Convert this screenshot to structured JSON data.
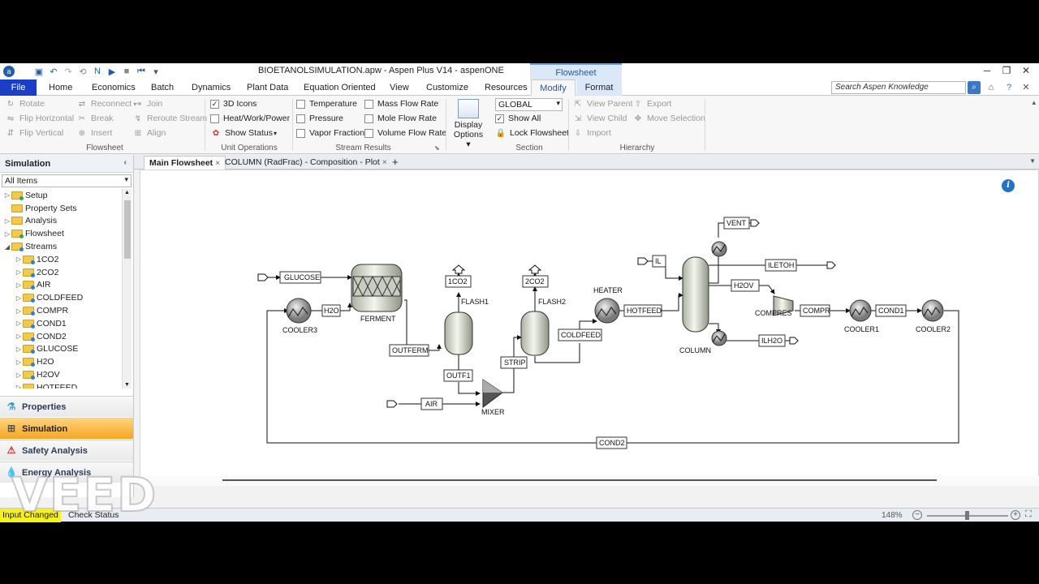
{
  "window": {
    "title": "BIOETANOLSIMULATION.apw - Aspen Plus V14 - aspenONE",
    "context_tab": "Flowsheet"
  },
  "ribbon_tabs": [
    "File",
    "Home",
    "Economics",
    "Batch",
    "Dynamics",
    "Plant Data",
    "Equation Oriented",
    "View",
    "Customize",
    "Resources",
    "Modify",
    "Format"
  ],
  "active_tab": "Modify",
  "search": {
    "placeholder": "Search Aspen Knowledge"
  },
  "ribbon": {
    "flowsheet_group": {
      "label": "Flowsheet",
      "rotate": "Rotate",
      "flip_h": "Flip Horizontal",
      "flip_v": "Flip Vertical",
      "reconnect": "Reconnect",
      "break": "Break",
      "insert": "Insert",
      "join": "Join",
      "reroute": "Reroute Stream",
      "align": "Align"
    },
    "unit_ops_group": {
      "label": "Unit Operations",
      "icons_3d": "3D Icons",
      "heat_work": "Heat/Work/Power",
      "show_status": "Show Status"
    },
    "stream_results_group": {
      "label": "Stream Results",
      "temperature": "Temperature",
      "pressure": "Pressure",
      "vapor_fraction": "Vapor Fraction",
      "mass_flow": "Mass Flow Rate",
      "mole_flow": "Mole Flow Rate",
      "volume_flow": "Volume Flow Rate"
    },
    "display_options": "Display Options",
    "section_group": {
      "label": "Section",
      "selected": "GLOBAL",
      "show_all": "Show All",
      "lock": "Lock Flowsheet"
    },
    "hierarchy_group": {
      "label": "Hierarchy",
      "view_parent": "View Parent",
      "view_child": "View Child",
      "import": "Import",
      "export": "Export",
      "move_selection": "Move Selection"
    }
  },
  "nav": {
    "header": "Simulation",
    "filter": "All Items",
    "tree": [
      {
        "label": "Setup",
        "level": 0,
        "exp": "▷",
        "mark": "green"
      },
      {
        "label": "Property Sets",
        "level": 0,
        "exp": "",
        "mark": ""
      },
      {
        "label": "Analysis",
        "level": 0,
        "exp": "▷",
        "mark": ""
      },
      {
        "label": "Flowsheet",
        "level": 0,
        "exp": "▷",
        "mark": "green"
      },
      {
        "label": "Streams",
        "level": 0,
        "exp": "◢",
        "mark": "blue"
      },
      {
        "label": "1CO2",
        "level": 1,
        "exp": "▷",
        "mark": "blue"
      },
      {
        "label": "2CO2",
        "level": 1,
        "exp": "▷",
        "mark": "blue"
      },
      {
        "label": "AIR",
        "level": 1,
        "exp": "▷",
        "mark": "blue"
      },
      {
        "label": "COLDFEED",
        "level": 1,
        "exp": "▷",
        "mark": "blue"
      },
      {
        "label": "COMPR",
        "level": 1,
        "exp": "▷",
        "mark": "blue"
      },
      {
        "label": "COND1",
        "level": 1,
        "exp": "▷",
        "mark": "blue"
      },
      {
        "label": "COND2",
        "level": 1,
        "exp": "▷",
        "mark": "blue"
      },
      {
        "label": "GLUCOSE",
        "level": 1,
        "exp": "▷",
        "mark": "blue"
      },
      {
        "label": "H2O",
        "level": 1,
        "exp": "▷",
        "mark": "blue"
      },
      {
        "label": "H2OV",
        "level": 1,
        "exp": "▷",
        "mark": "blue"
      },
      {
        "label": "HOTFEED",
        "level": 1,
        "exp": "▷",
        "mark": "blue"
      }
    ],
    "buttons": [
      "Properties",
      "Simulation",
      "Safety Analysis",
      "Energy Analysis"
    ]
  },
  "doc_tabs": [
    "Main Flowsheet",
    "COLUMN (RadFrac) - Composition - Plot"
  ],
  "flowsheet": {
    "blocks": {
      "ferment": "FERMENT",
      "cooler3": "COOLER3",
      "flash1": "FLASH1",
      "flash2": "FLASH2",
      "mixer": "MIXER",
      "heater": "HEATER",
      "column": "COLUMN",
      "compres": "COMPRES",
      "cooler1": "COOLER1",
      "cooler2": "COOLER2"
    },
    "streams": {
      "glucose": "GLUCOSE",
      "h2o": "H2O",
      "outferm": "OUTFERM",
      "co2_1": "1CO2",
      "co2_2": "2CO2",
      "outf1": "OUTF1",
      "air": "AIR",
      "strip": "STRIP",
      "coldfeed": "COLDFEED",
      "hotfeed": "HOTFEED",
      "il": "IL",
      "vent": "VENT",
      "iletoh": "ILETOH",
      "h2ov": "H2OV",
      "ilh2o": "ILH2O",
      "compr": "COMPR",
      "cond1": "COND1",
      "cond2": "COND2"
    }
  },
  "status": {
    "input_changed": "Input Changed",
    "check_status": "Check Status",
    "zoom": "148%"
  },
  "watermark": "VEED"
}
